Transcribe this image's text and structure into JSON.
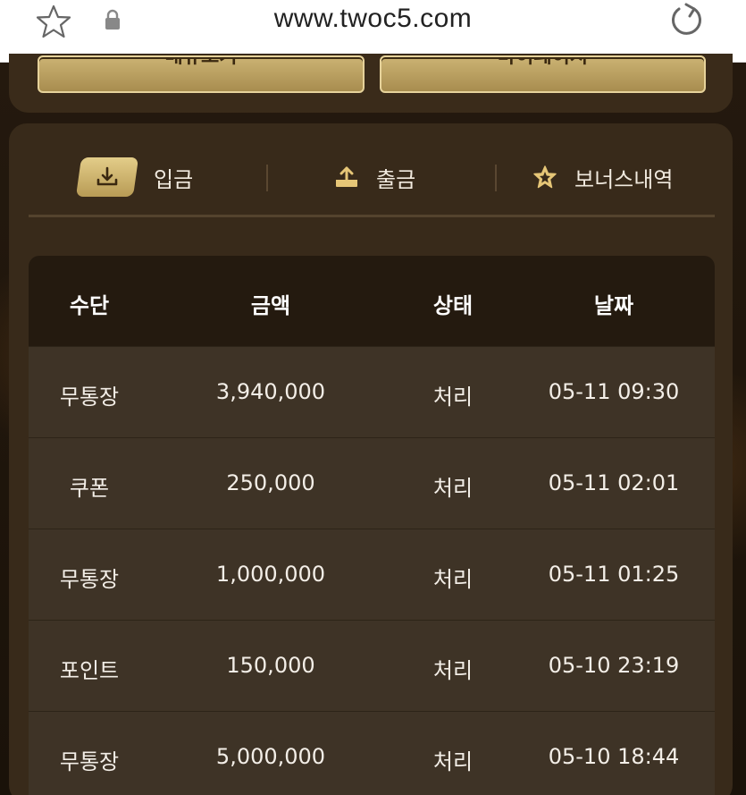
{
  "browser": {
    "url": "www.twoc5.com"
  },
  "top_buttons": {
    "left_label": "배유보기",
    "right_label": "마이페이지"
  },
  "tabs": [
    {
      "label": "입금",
      "icon": "download-icon",
      "active": true
    },
    {
      "label": "출금",
      "icon": "upload-icon",
      "active": false
    },
    {
      "label": "보너스내역",
      "icon": "star-icon",
      "active": false
    }
  ],
  "table": {
    "headers": [
      "수단",
      "금액",
      "상태",
      "날짜"
    ],
    "rows": [
      {
        "method": "무통장",
        "amount": "3,940,000",
        "status": "처리",
        "date": "05-11 09:30"
      },
      {
        "method": "쿠폰",
        "amount": "250,000",
        "status": "처리",
        "date": "05-11 02:01"
      },
      {
        "method": "무통장",
        "amount": "1,000,000",
        "status": "처리",
        "date": "05-11 01:25"
      },
      {
        "method": "포인트",
        "amount": "150,000",
        "status": "처리",
        "date": "05-10 23:19"
      },
      {
        "method": "무통장",
        "amount": "5,000,000",
        "status": "처리",
        "date": "05-10 18:44"
      }
    ]
  },
  "colors": {
    "gold": "#cbb373",
    "panel": "#382a1a",
    "header_row": "#241a0f",
    "row": "#3e3326"
  }
}
